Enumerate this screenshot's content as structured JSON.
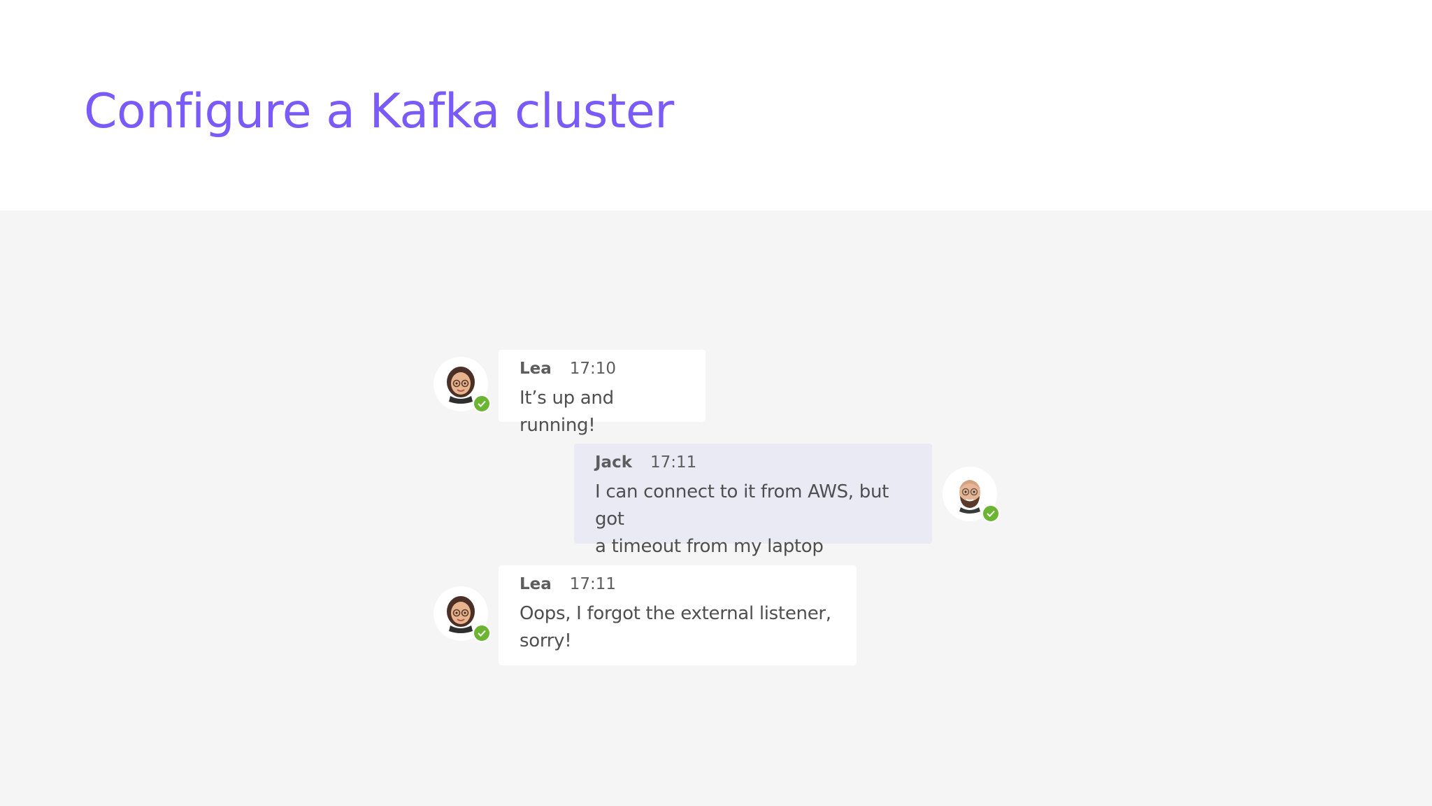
{
  "title": "Configure a Kafka cluster",
  "colors": {
    "title": "#7a5af8",
    "chat_background": "#f5f5f5",
    "own_bubble": "#e9eaf4",
    "other_bubble": "#ffffff",
    "presence_available": "#6bb533"
  },
  "messages": [
    {
      "sender": "Lea",
      "time": "17:10",
      "text": "It’s up and running!",
      "avatar": "lea-memoji-avatar",
      "presence": "available-check-icon"
    },
    {
      "sender": "Jack",
      "time": "17:11",
      "text_lines": [
        "I can connect to it from AWS, but got",
        "a timeout from my laptop"
      ],
      "avatar": "jack-memoji-avatar",
      "presence": "available-check-icon"
    },
    {
      "sender": "Lea",
      "time": "17:11",
      "text_lines": [
        "Oops, I forgot the external listener,",
        "sorry!"
      ],
      "avatar": "lea-memoji-avatar",
      "presence": "available-check-icon"
    }
  ]
}
